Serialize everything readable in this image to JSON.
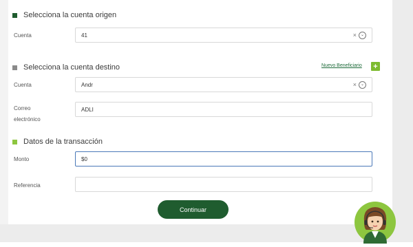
{
  "origin": {
    "title": "Selecciona la cuenta origen",
    "account_label": "Cuenta",
    "account_value": "41"
  },
  "destination": {
    "title": "Selecciona la cuenta destino",
    "new_beneficiary_link": "Nuevo Beneficiario",
    "add_symbol": "+",
    "account_label": "Cuenta",
    "account_value": "Andr",
    "email_label_line1": "Correo",
    "email_label_line2": "electrónico",
    "email_value": "ADLI"
  },
  "transaction": {
    "title": "Datos de la transacción",
    "amount_label": "Monto",
    "amount_value": "$0",
    "reference_label": "Referencia",
    "reference_value": ""
  },
  "actions": {
    "continue_label": "Continuar"
  },
  "icons": {
    "clear": "×",
    "dropdown": "⌄"
  },
  "colors": {
    "brand_dark_green": "#1f5c2f",
    "accent_lime": "#8dc63f",
    "focus_blue": "#4a78b8"
  }
}
